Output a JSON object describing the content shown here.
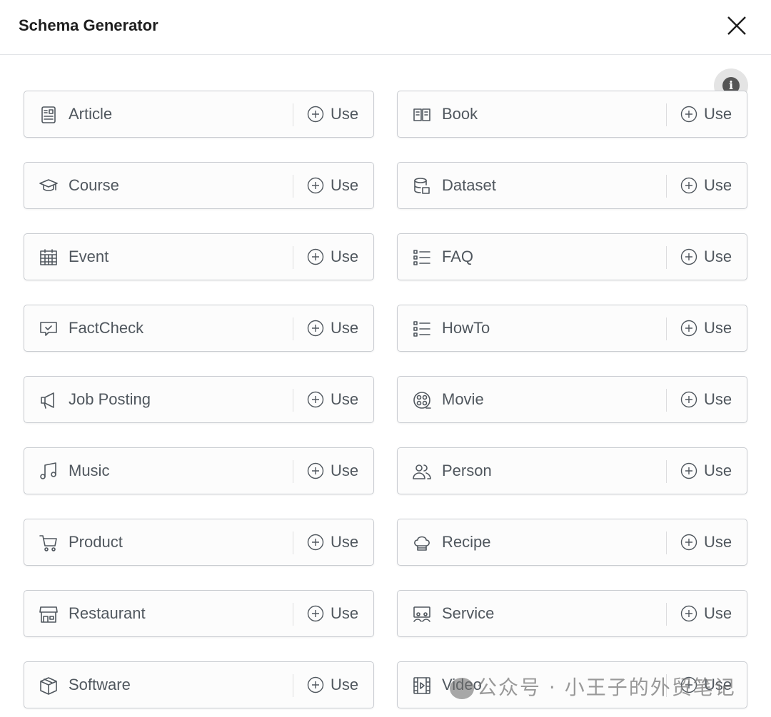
{
  "header": {
    "title": "Schema Generator",
    "close_icon": "close-icon",
    "info_icon": "info-icon"
  },
  "use_label": "Use",
  "schemas": [
    {
      "label": "Article",
      "icon": "article"
    },
    {
      "label": "Book",
      "icon": "book"
    },
    {
      "label": "Course",
      "icon": "course"
    },
    {
      "label": "Dataset",
      "icon": "dataset"
    },
    {
      "label": "Event",
      "icon": "event"
    },
    {
      "label": "FAQ",
      "icon": "list"
    },
    {
      "label": "FactCheck",
      "icon": "factcheck"
    },
    {
      "label": "HowTo",
      "icon": "list"
    },
    {
      "label": "Job Posting",
      "icon": "megaphone"
    },
    {
      "label": "Movie",
      "icon": "movie"
    },
    {
      "label": "Music",
      "icon": "music"
    },
    {
      "label": "Person",
      "icon": "person"
    },
    {
      "label": "Product",
      "icon": "cart"
    },
    {
      "label": "Recipe",
      "icon": "chef-hat"
    },
    {
      "label": "Restaurant",
      "icon": "store"
    },
    {
      "label": "Service",
      "icon": "service"
    },
    {
      "label": "Software",
      "icon": "box"
    },
    {
      "label": "Video",
      "icon": "video"
    }
  ],
  "watermark": "公众号 · 小王子的外贸笔记"
}
